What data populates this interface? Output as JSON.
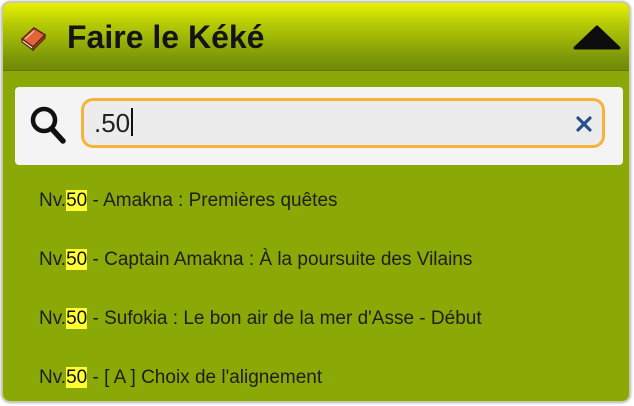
{
  "panel": {
    "title": "Faire le Kéké",
    "title_icon": "book-icon",
    "collapse_icon": "triangle-up-icon"
  },
  "search": {
    "value": ".50",
    "search_icon": "search-icon",
    "clear_icon": "close-icon"
  },
  "results": [
    {
      "prefix": "Nv.",
      "match": "50",
      "text": " - Amakna : Premières quêtes"
    },
    {
      "prefix": "Nv.",
      "match": "50",
      "text": " - Captain Amakna : À la poursuite des Vilains"
    },
    {
      "prefix": "Nv.",
      "match": "50",
      "text": " - Sufokia : Le bon air de la mer d'Asse - Début"
    },
    {
      "prefix": "Nv.",
      "match": "50",
      "text": " - [ A ] Choix de l'alignement"
    }
  ],
  "colors": {
    "panel_green": "#8aa806",
    "header_top": "#e8f000",
    "header_bottom": "#6f8907",
    "search_border": "#f5b437",
    "highlight": "#ffff33",
    "clear_icon": "#2a4f8a"
  }
}
